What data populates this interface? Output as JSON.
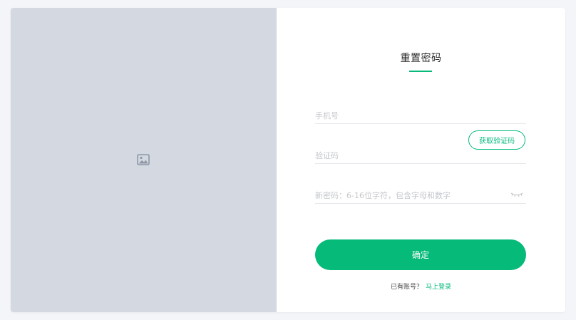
{
  "image_panel": {
    "icon": "image-placeholder-icon"
  },
  "form": {
    "title": "重置密码",
    "phone": {
      "placeholder": "手机号",
      "value": ""
    },
    "code": {
      "placeholder": "验证码",
      "value": "",
      "get_code_label": "获取验证码"
    },
    "password": {
      "placeholder": "新密码：6-16位字符，包含字母和数字",
      "value": "",
      "toggle_icon": "eye-closed-icon"
    },
    "submit_label": "确定",
    "footer": {
      "prompt": "已有账号？",
      "login_link": "马上登录"
    }
  },
  "colors": {
    "accent": "#06ba7a",
    "panel_background": "#d3d8e1",
    "page_background": "#f4f5f9",
    "placeholder_text": "#c4c7cc"
  }
}
